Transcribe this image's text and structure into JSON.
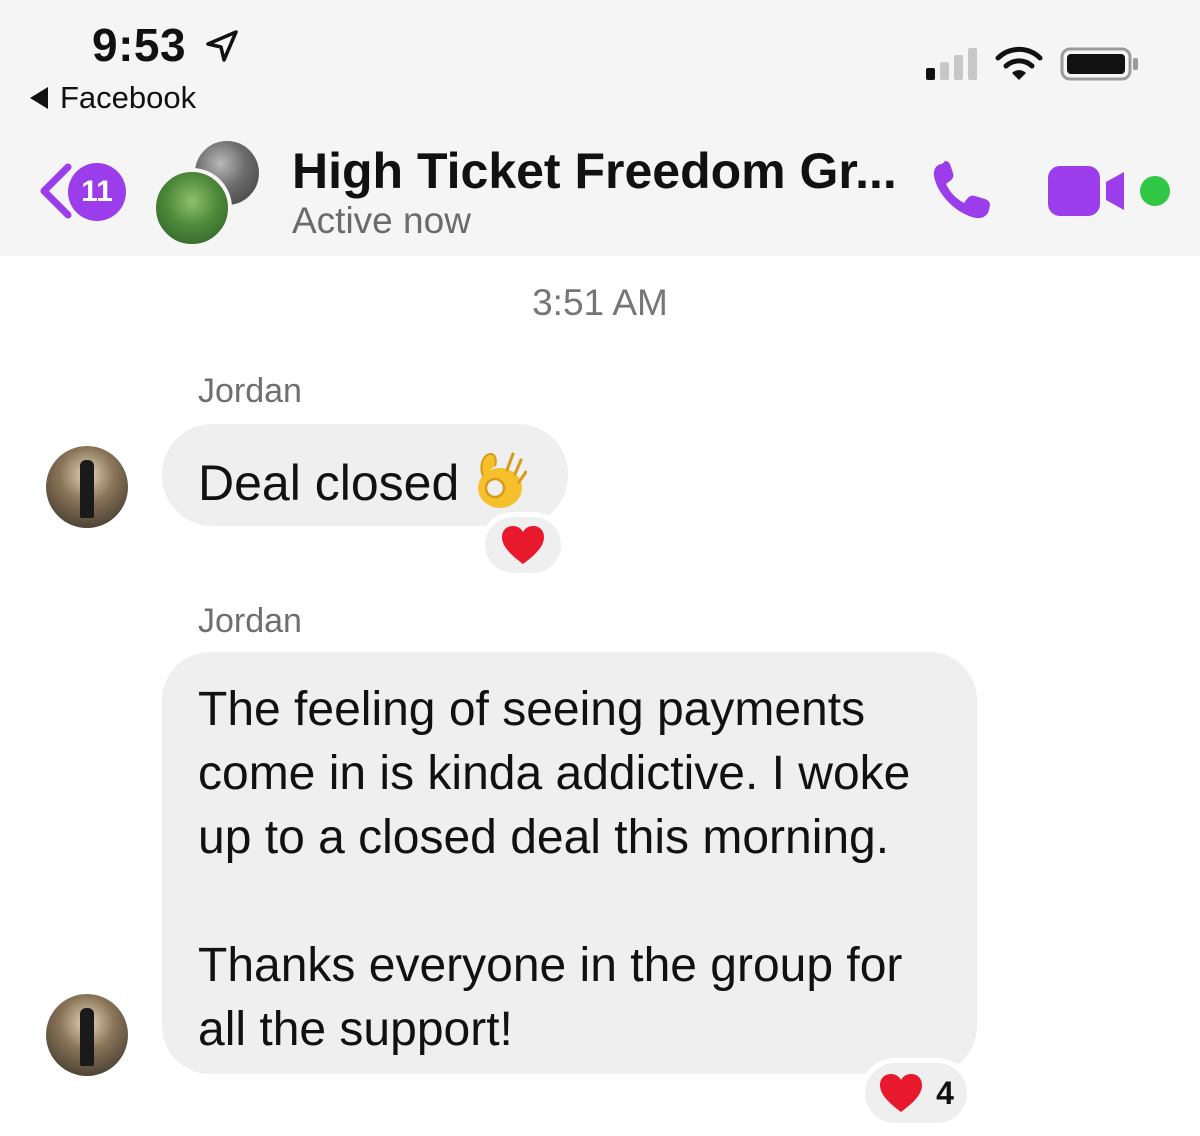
{
  "status_bar": {
    "time": "9:53",
    "back_app_label": "Facebook",
    "icons": [
      "location-arrow-icon",
      "signal-bars-icon",
      "wifi-icon",
      "battery-icon"
    ]
  },
  "header": {
    "unread_count": "11",
    "title": "High Ticket Freedom Gr...",
    "subtitle": "Active now",
    "icons": [
      "back-chevron-icon",
      "phone-icon",
      "video-camera-icon"
    ],
    "accent_color": "#9b3dea",
    "active_indicator_color": "#31c845"
  },
  "conversation": {
    "timestamp": "3:51 AM",
    "messages": [
      {
        "sender": "Jordan",
        "text": "Deal closed",
        "emoji": "ok-hand-icon",
        "reaction": {
          "emoji": "heart-icon",
          "count": ""
        }
      },
      {
        "sender": "Jordan",
        "paragraphs": [
          "The feeling of seeing payments\ncome in is kinda addictive. I woke\nup to a closed deal this morning.",
          "Thanks everyone in the group for\nall the support!"
        ],
        "reaction": {
          "emoji": "heart-icon",
          "count": "4"
        }
      }
    ]
  }
}
